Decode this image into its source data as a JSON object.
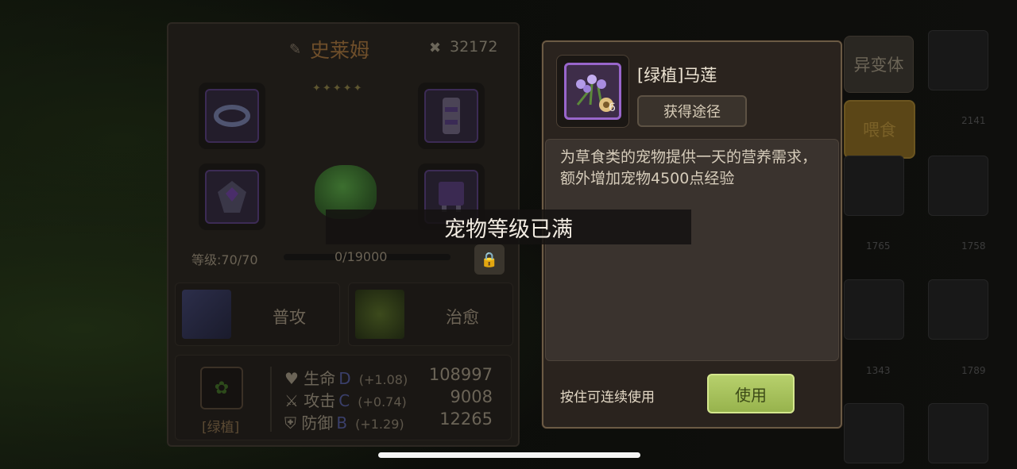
{
  "pet": {
    "name": "史莱姆",
    "power": "32172",
    "level": "等级:70/70",
    "exp": "0/19000",
    "skills": [
      "普攻",
      "治愈"
    ],
    "food_type": "[绿植]",
    "stats": [
      {
        "name": "生命",
        "grade": "D",
        "growth": "(+1.08)",
        "value": "108997"
      },
      {
        "name": "攻击",
        "grade": "C",
        "growth": "(+0.74)",
        "value": "9008"
      },
      {
        "name": "防御",
        "grade": "B",
        "growth": "(+1.29)",
        "value": "12265"
      }
    ]
  },
  "tabs": {
    "mutant": "异变体",
    "feed": "喂食"
  },
  "grid_numbers": [
    "2141",
    "1765",
    "1758",
    "1343",
    "1789"
  ],
  "item": {
    "name": "[绿植]马莲",
    "count": "6",
    "source_button": "获得途径",
    "description": "为草食类的宠物提供一天的营养需求，额外增加宠物4500点经验",
    "hold_hint": "按住可连续使用",
    "use_button": "使用"
  },
  "toast": "宠物等级已满",
  "colors": {
    "use_button": "#a8c45c",
    "rarity_border": "#9966cc",
    "popup_border": "#6b5a44"
  }
}
